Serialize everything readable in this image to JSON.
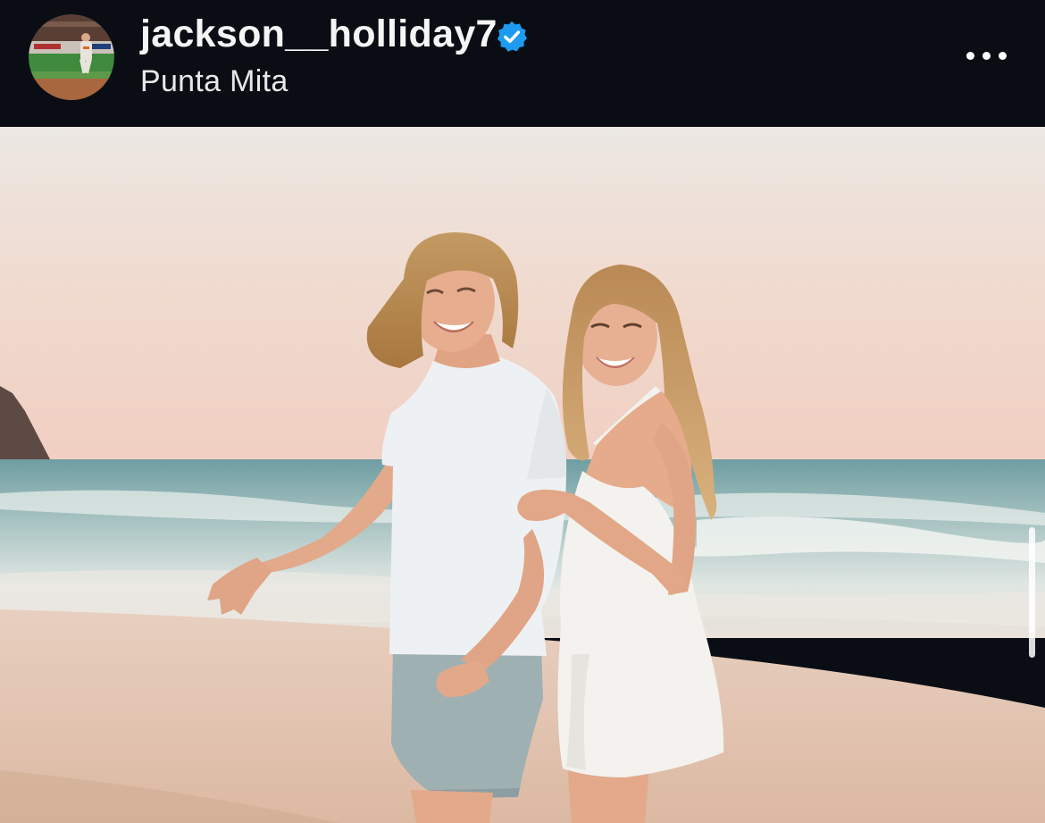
{
  "post": {
    "username": "jackson__holliday7",
    "verified": true,
    "location": "Punta Mita"
  },
  "icons": {
    "avatar": "profile-photo-baseball-player",
    "verified": "verified-badge-icon",
    "more": "more-options-icon"
  },
  "colors": {
    "header_bg": "#0a0e14",
    "verified_blue": "#1d9bf0",
    "text": "#f5f5f5"
  }
}
